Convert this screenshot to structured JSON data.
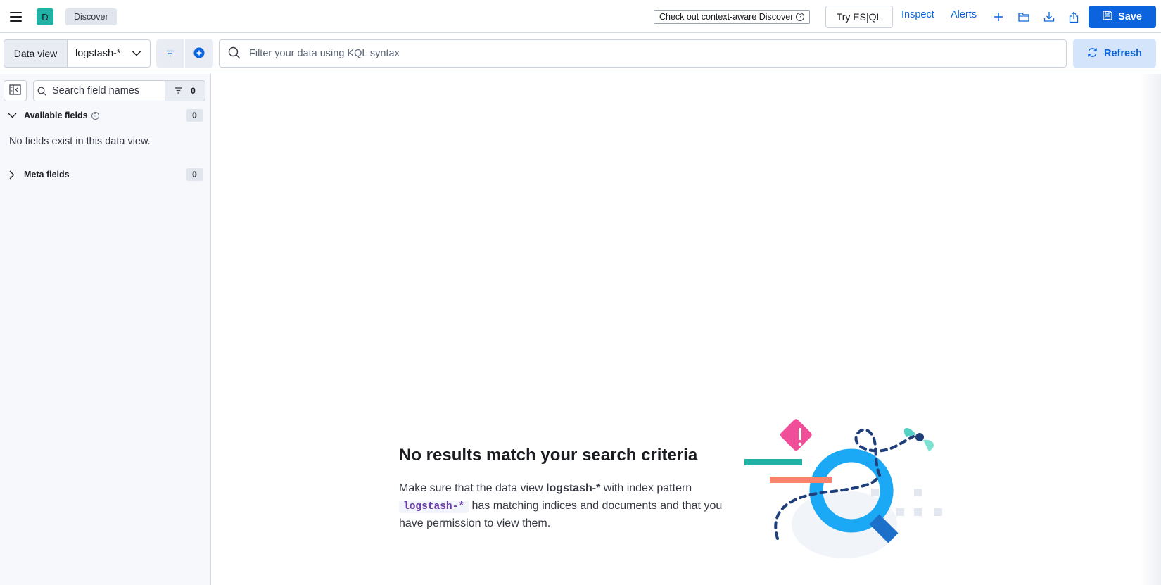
{
  "header": {
    "app_initial": "D",
    "breadcrumb": "Discover",
    "context_link": "Check out context-aware Discover",
    "try_esql": "Try ES|QL",
    "inspect": "Inspect",
    "alerts": "Alerts",
    "save": "Save",
    "icons": [
      "menu-icon",
      "plus-icon",
      "folder-open-icon",
      "download-icon",
      "share-icon",
      "save-icon"
    ]
  },
  "query": {
    "data_view_label": "Data view",
    "data_view_value": "logstash-*",
    "kql_placeholder": "Filter your data using KQL syntax",
    "refresh": "Refresh"
  },
  "sidebar": {
    "search_placeholder": "Search field names",
    "filter_count": "0",
    "available_fields": {
      "label": "Available fields",
      "count": "0"
    },
    "empty_message": "No fields exist in this data view.",
    "meta_fields": {
      "label": "Meta fields",
      "count": "0"
    }
  },
  "empty_state": {
    "title": "No results match your search criteria",
    "body_prefix": "Make sure that the data view ",
    "data_view_name": "logstash-*",
    "body_mid": " with index pattern ",
    "index_pattern": "logstash-*",
    "body_suffix": " has matching indices and documents and that you have permission to view them."
  },
  "colors": {
    "primary": "#0b64dd",
    "app_avatar": "#20b2a5",
    "sidebar_bg": "#f7f8fc",
    "code_text": "#6c3ba6"
  }
}
